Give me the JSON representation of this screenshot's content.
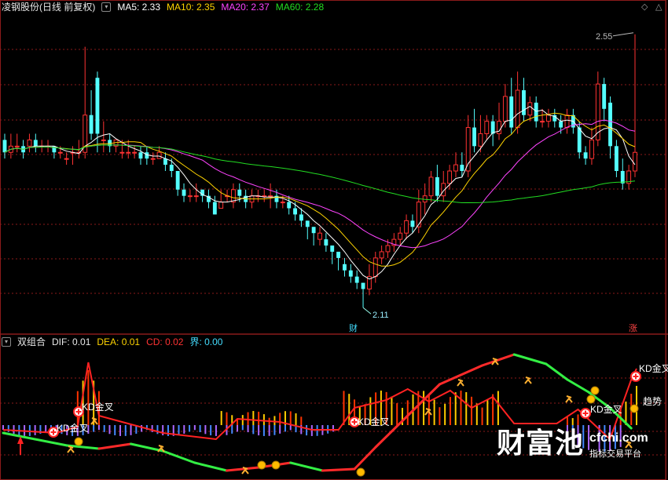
{
  "main_header": {
    "title": "凌钢股份(日线 前复权)",
    "ma": [
      {
        "label": "MA5: 2.33",
        "color": "#ffffff"
      },
      {
        "label": "MA10: 2.35",
        "color": "#ffd400"
      },
      {
        "label": "MA20: 2.37",
        "color": "#ff44ff"
      },
      {
        "label": "MA60: 2.28",
        "color": "#22dd22"
      }
    ]
  },
  "sub_header": {
    "title": "双组合",
    "items": [
      {
        "label": "DIF: 0.01",
        "color": "#e8e8e8"
      },
      {
        "label": "DEA: 0.01",
        "color": "#ffd400"
      },
      {
        "label": "CD: 0.02",
        "color": "#ff3333"
      },
      {
        "label": "界: 0.00",
        "color": "#44ddff"
      }
    ]
  },
  "annotations": {
    "high_price": "2.55",
    "low_price": "2.11",
    "cai_mark": "财",
    "zhang_mark": "涨",
    "kd1": "KD金叉",
    "kd2": "KD金叉",
    "kd3": "KD金叉",
    "kd4": "KD金叉",
    "kd5": "KD金叉",
    "qushi": "趋势"
  },
  "logo": {
    "brand": "财富池",
    "site": "cfchi.com",
    "tagline": "指标交易平台"
  },
  "colors": {
    "up": "#ff3232",
    "down": "#54ffff",
    "grid": "#8b1a1a",
    "ma5": "#ffffff",
    "ma10": "#ffd400",
    "ma20": "#ff44ff",
    "ma60": "#22dd22"
  },
  "chart_data": {
    "type": "candlestick",
    "ylim": [
      2.08,
      2.58
    ],
    "high_label": 2.55,
    "low_label": 2.11,
    "candles": [
      [
        2.38,
        2.36,
        2.39,
        2.35
      ],
      [
        2.36,
        2.37,
        2.39,
        2.35
      ],
      [
        2.37,
        2.37,
        2.39,
        2.36
      ],
      [
        2.37,
        2.36,
        2.38,
        2.35
      ],
      [
        2.37,
        2.38,
        2.39,
        2.36
      ],
      [
        2.38,
        2.37,
        2.39,
        2.36
      ],
      [
        2.37,
        2.37,
        2.38,
        2.36
      ],
      [
        2.37,
        2.37,
        2.38,
        2.36
      ],
      [
        2.37,
        2.36,
        2.37,
        2.35
      ],
      [
        2.36,
        2.36,
        2.37,
        2.35
      ],
      [
        2.35,
        2.35,
        2.36,
        2.34
      ],
      [
        2.36,
        2.36,
        2.37,
        2.34
      ],
      [
        2.36,
        2.36,
        2.38,
        2.35
      ],
      [
        2.36,
        2.42,
        2.53,
        2.35
      ],
      [
        2.42,
        2.39,
        2.46,
        2.38
      ],
      [
        2.48,
        2.39,
        2.49,
        2.36
      ],
      [
        2.38,
        2.38,
        2.41,
        2.36
      ],
      [
        2.38,
        2.37,
        2.39,
        2.36
      ],
      [
        2.37,
        2.38,
        2.38,
        2.36
      ],
      [
        2.36,
        2.36,
        2.38,
        2.35
      ],
      [
        2.36,
        2.36,
        2.38,
        2.35
      ],
      [
        2.36,
        2.36,
        2.37,
        2.35
      ],
      [
        2.36,
        2.35,
        2.37,
        2.34
      ],
      [
        2.36,
        2.35,
        2.37,
        2.34
      ],
      [
        2.35,
        2.35,
        2.36,
        2.34
      ],
      [
        2.35,
        2.36,
        2.37,
        2.35
      ],
      [
        2.35,
        2.34,
        2.36,
        2.33
      ],
      [
        2.34,
        2.33,
        2.35,
        2.32
      ],
      [
        2.33,
        2.3,
        2.33,
        2.29
      ],
      [
        2.3,
        2.29,
        2.31,
        2.28
      ],
      [
        2.29,
        2.29,
        2.3,
        2.28
      ],
      [
        2.29,
        2.29,
        2.31,
        2.28
      ],
      [
        2.3,
        2.29,
        2.3,
        2.28
      ],
      [
        2.29,
        2.28,
        2.3,
        2.27
      ],
      [
        2.28,
        2.26,
        2.29,
        2.26
      ],
      [
        2.27,
        2.28,
        2.3,
        2.27
      ],
      [
        2.29,
        2.29,
        2.3,
        2.28
      ],
      [
        2.28,
        2.3,
        2.31,
        2.27
      ],
      [
        2.3,
        2.29,
        2.31,
        2.28
      ],
      [
        2.29,
        2.28,
        2.3,
        2.27
      ],
      [
        2.28,
        2.29,
        2.3,
        2.27
      ],
      [
        2.29,
        2.29,
        2.3,
        2.28
      ],
      [
        2.29,
        2.29,
        2.3,
        2.28
      ],
      [
        2.29,
        2.29,
        2.31,
        2.27
      ],
      [
        2.29,
        2.28,
        2.3,
        2.27
      ],
      [
        2.28,
        2.28,
        2.29,
        2.27
      ],
      [
        2.28,
        2.27,
        2.29,
        2.26
      ],
      [
        2.27,
        2.26,
        2.28,
        2.25
      ],
      [
        2.26,
        2.25,
        2.27,
        2.24
      ],
      [
        2.25,
        2.24,
        2.25,
        2.22
      ],
      [
        2.24,
        2.23,
        2.24,
        2.21
      ],
      [
        2.22,
        2.23,
        2.24,
        2.21
      ],
      [
        2.22,
        2.21,
        2.23,
        2.2
      ],
      [
        2.21,
        2.2,
        2.21,
        2.18
      ],
      [
        2.2,
        2.19,
        2.2,
        2.17
      ],
      [
        2.18,
        2.17,
        2.19,
        2.16
      ],
      [
        2.17,
        2.16,
        2.18,
        2.15
      ],
      [
        2.16,
        2.15,
        2.17,
        2.14
      ],
      [
        2.15,
        2.14,
        2.15,
        2.11
      ],
      [
        2.14,
        2.16,
        2.18,
        2.13
      ],
      [
        2.16,
        2.19,
        2.2,
        2.15
      ],
      [
        2.19,
        2.2,
        2.21,
        2.18
      ],
      [
        2.2,
        2.21,
        2.22,
        2.19
      ],
      [
        2.21,
        2.22,
        2.23,
        2.2
      ],
      [
        2.22,
        2.23,
        2.24,
        2.21
      ],
      [
        2.23,
        2.25,
        2.26,
        2.22
      ],
      [
        2.25,
        2.24,
        2.26,
        2.23
      ],
      [
        2.24,
        2.28,
        2.3,
        2.23
      ],
      [
        2.28,
        2.29,
        2.31,
        2.26
      ],
      [
        2.29,
        2.32,
        2.33,
        2.28
      ],
      [
        2.32,
        2.29,
        2.34,
        2.28
      ],
      [
        2.29,
        2.31,
        2.33,
        2.28
      ],
      [
        2.31,
        2.33,
        2.34,
        2.3
      ],
      [
        2.33,
        2.34,
        2.36,
        2.32
      ],
      [
        2.34,
        2.33,
        2.36,
        2.32
      ],
      [
        2.33,
        2.4,
        2.42,
        2.32
      ],
      [
        2.4,
        2.37,
        2.43,
        2.36
      ],
      [
        2.37,
        2.39,
        2.42,
        2.36
      ],
      [
        2.39,
        2.41,
        2.42,
        2.38
      ],
      [
        2.41,
        2.39,
        2.42,
        2.37
      ],
      [
        2.39,
        2.41,
        2.44,
        2.38
      ],
      [
        2.41,
        2.45,
        2.47,
        2.4
      ],
      [
        2.45,
        2.4,
        2.48,
        2.39
      ],
      [
        2.4,
        2.46,
        2.49,
        2.39
      ],
      [
        2.46,
        2.42,
        2.48,
        2.41
      ],
      [
        2.42,
        2.44,
        2.45,
        2.41
      ],
      [
        2.44,
        2.41,
        2.45,
        2.4
      ],
      [
        2.41,
        2.41,
        2.43,
        2.4
      ],
      [
        2.41,
        2.42,
        2.43,
        2.4
      ],
      [
        2.42,
        2.41,
        2.43,
        2.4
      ],
      [
        2.41,
        2.4,
        2.42,
        2.39
      ],
      [
        2.4,
        2.42,
        2.43,
        2.39
      ],
      [
        2.42,
        2.4,
        2.43,
        2.39
      ],
      [
        2.4,
        2.36,
        2.41,
        2.35
      ],
      [
        2.36,
        2.35,
        2.37,
        2.34
      ],
      [
        2.35,
        2.38,
        2.4,
        2.34
      ],
      [
        2.38,
        2.47,
        2.49,
        2.37
      ],
      [
        2.47,
        2.43,
        2.48,
        2.41
      ],
      [
        2.44,
        2.37,
        2.45,
        2.35
      ],
      [
        2.37,
        2.33,
        2.38,
        2.32
      ],
      [
        2.33,
        2.31,
        2.35,
        2.3
      ],
      [
        2.31,
        2.33,
        2.34,
        2.3
      ],
      [
        2.33,
        2.36,
        2.55,
        2.32
      ]
    ]
  }
}
